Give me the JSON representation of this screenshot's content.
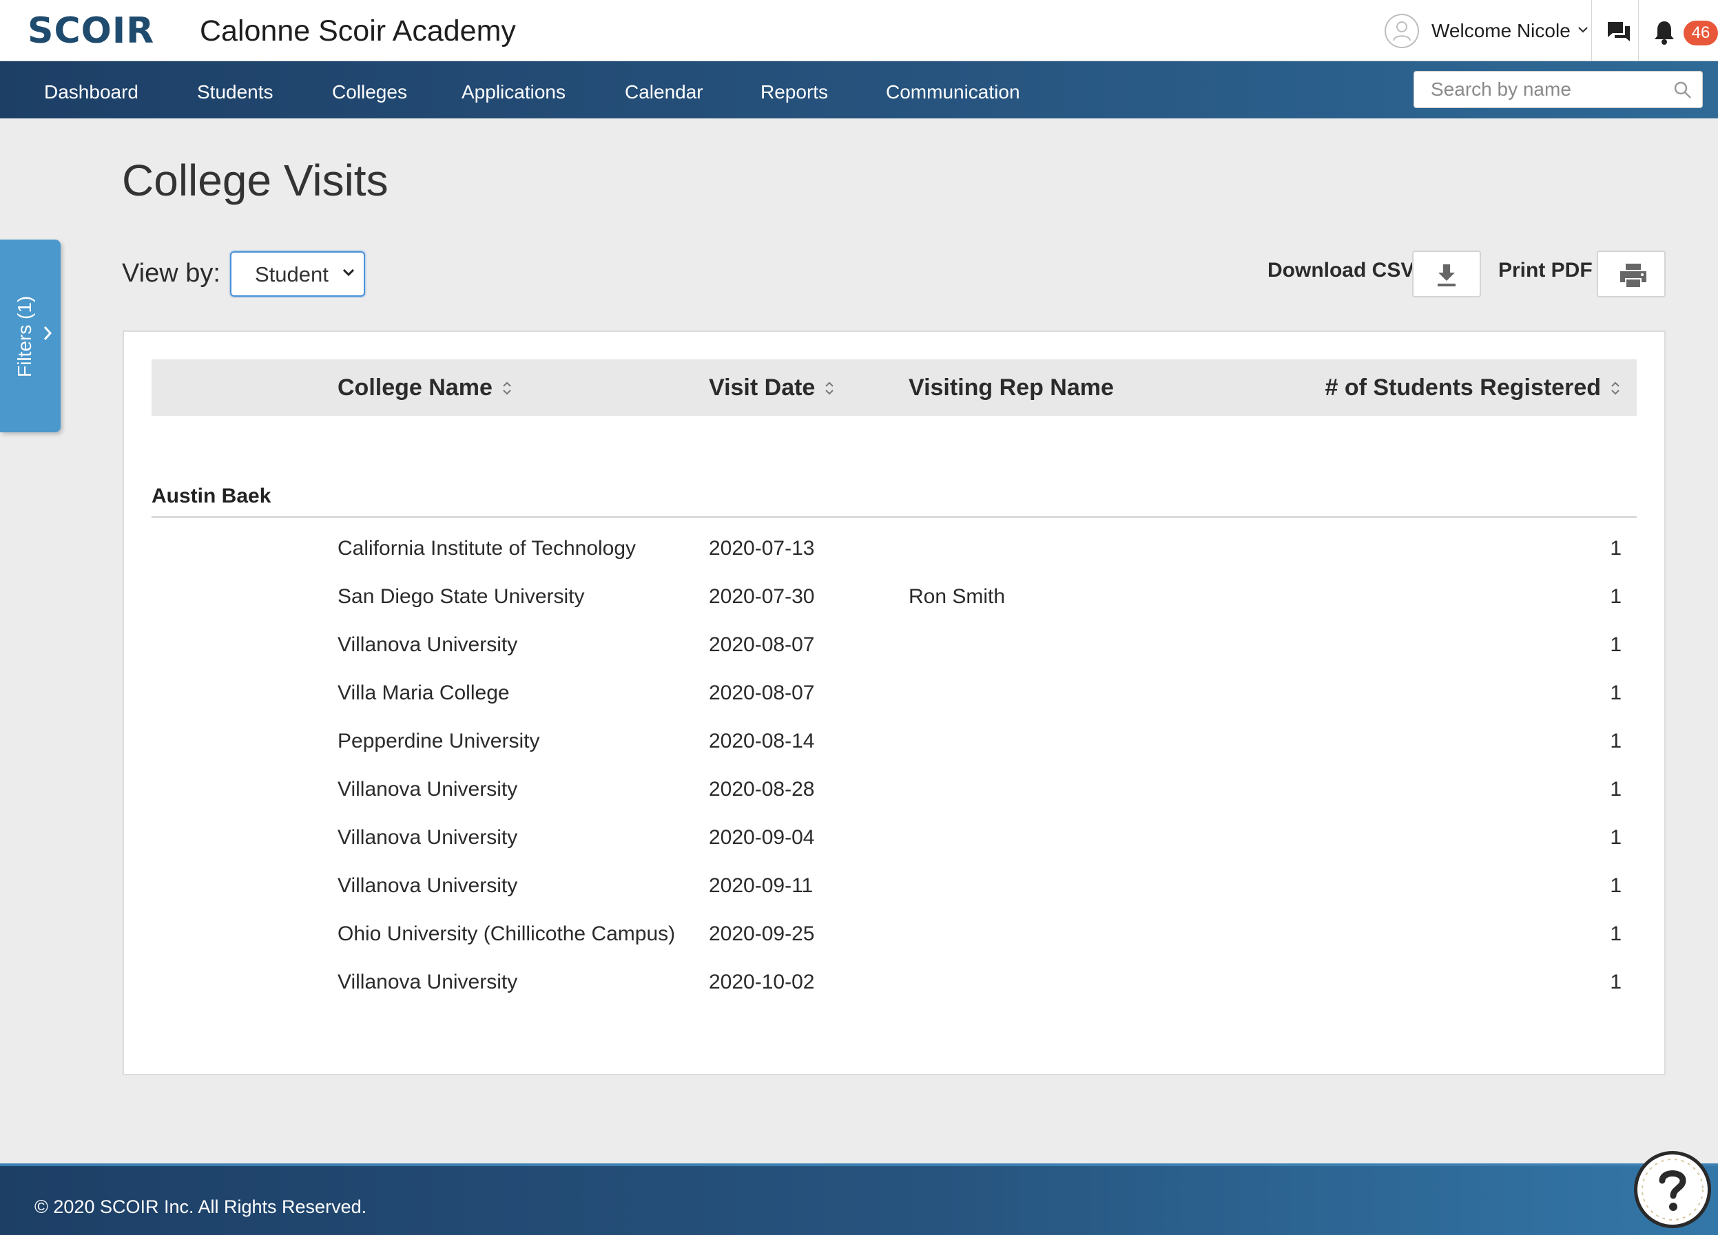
{
  "header": {
    "logo_text": "SCOIR",
    "school_name": "Calonne Scoir Academy",
    "welcome": "Welcome Nicole",
    "notification_count": "46"
  },
  "nav": {
    "items": [
      {
        "label": "Dashboard"
      },
      {
        "label": "Students"
      },
      {
        "label": "Colleges"
      },
      {
        "label": "Applications"
      },
      {
        "label": "Calendar"
      },
      {
        "label": "Reports"
      },
      {
        "label": "Communication"
      }
    ],
    "search_placeholder": "Search by name"
  },
  "filters": {
    "label": "Filters (1)"
  },
  "page": {
    "title": "College Visits",
    "view_by_label": "View by:",
    "view_by_value": "Student",
    "download_csv_label": "Download CSV",
    "print_pdf_label": "Print PDF"
  },
  "table": {
    "columns": {
      "college": "College Name",
      "date": "Visit Date",
      "rep": "Visiting Rep Name",
      "count": "# of Students Registered"
    },
    "group": {
      "name": "Austin Baek",
      "rows": [
        {
          "college": "California Institute of Technology",
          "date": "2020-07-13",
          "rep": "",
          "count": "1"
        },
        {
          "college": "San Diego State University",
          "date": "2020-07-30",
          "rep": "Ron Smith",
          "count": "1"
        },
        {
          "college": "Villanova University",
          "date": "2020-08-07",
          "rep": "",
          "count": "1"
        },
        {
          "college": "Villa Maria College",
          "date": "2020-08-07",
          "rep": "",
          "count": "1"
        },
        {
          "college": "Pepperdine University",
          "date": "2020-08-14",
          "rep": "",
          "count": "1"
        },
        {
          "college": "Villanova University",
          "date": "2020-08-28",
          "rep": "",
          "count": "1"
        },
        {
          "college": "Villanova University",
          "date": "2020-09-04",
          "rep": "",
          "count": "1"
        },
        {
          "college": "Villanova University",
          "date": "2020-09-11",
          "rep": "",
          "count": "1"
        },
        {
          "college": "Ohio University (Chillicothe Campus)",
          "date": "2020-09-25",
          "rep": "",
          "count": "1"
        },
        {
          "college": "Villanova University",
          "date": "2020-10-02",
          "rep": "",
          "count": "1"
        }
      ]
    }
  },
  "footer": {
    "copyright": "© 2020 SCOIR Inc. All Rights Reserved."
  },
  "icons": {
    "avatar": "user-icon",
    "chat": "chat-icon",
    "bell": "bell-icon",
    "search": "search-icon",
    "download": "download-icon",
    "print": "printer-icon",
    "help": "help-icon"
  },
  "colors": {
    "nav_bg": "#1d3f66",
    "accent": "#4a98cc",
    "badge": "#e8573a",
    "brand": "#1f4b6e"
  }
}
